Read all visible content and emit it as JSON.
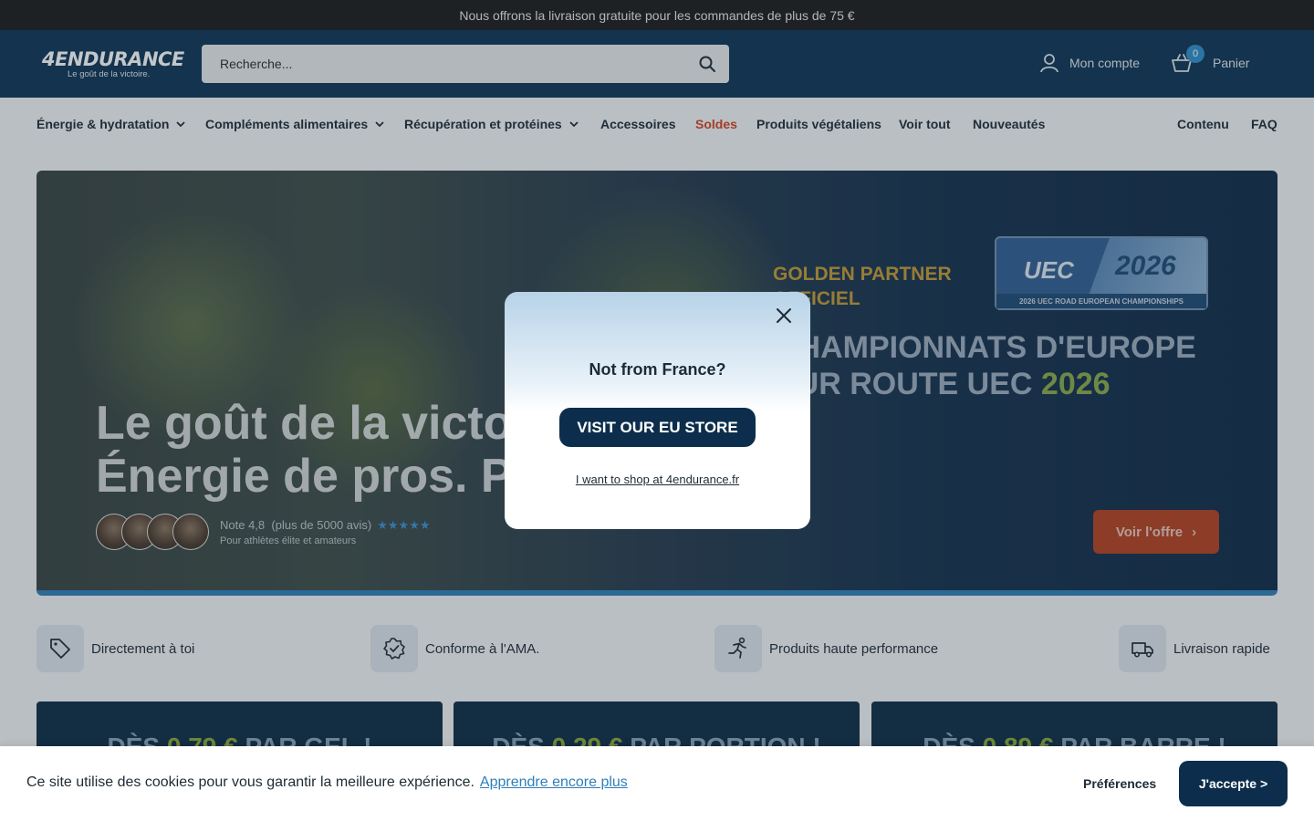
{
  "announcement": {
    "text": "Nous offrons la livraison gratuite pour les commandes de plus de 75 €"
  },
  "header": {
    "logo_text": "4ENDURANCE",
    "logo_tagline": "Le goût de la victoire.",
    "search_placeholder": "Recherche...",
    "account_label": "Mon compte",
    "cart_label": "Panier",
    "cart_count": "0"
  },
  "nav": {
    "items": [
      {
        "label": "Énergie & hydratation",
        "dropdown": true
      },
      {
        "label": "Compléments alimentaires",
        "dropdown": true
      },
      {
        "label": "Récupération et protéines",
        "dropdown": true
      },
      {
        "label": "Accessoires"
      },
      {
        "label": "Soldes",
        "color": "#d2421f"
      },
      {
        "label": "Produits végétaliens"
      },
      {
        "label": "Voir tout"
      },
      {
        "label": "Nouveautés"
      }
    ],
    "right_items": [
      {
        "label": "Contenu"
      },
      {
        "label": "FAQ"
      }
    ]
  },
  "hero": {
    "title_line1": "Le goût de la victoi",
    "title_line2": "Énergie de pros. Pr",
    "partner_line1": "GOLDEN PARTNER",
    "partner_line2": "OFFICIEL",
    "champ_line1": "CHAMPIONNATS D'EUROPE",
    "champ_line2_pre": "SUR ROUTE UEC ",
    "champ_line2_year": "2026",
    "badge_uec": "UEC",
    "badge_year": "2026",
    "badge_strip": "2026 UEC ROAD EUROPEAN CHAMPIONSHIPS",
    "rating_label": "Note 4,8",
    "rating_count": "(plus de 5000 avis)",
    "rating_stars": "★★★★★",
    "rating_stars_value": 4.8,
    "rating_sub": "Pour athlètes élite et amateurs",
    "offer_button": "Voir l'offre"
  },
  "features": [
    {
      "label": "Directement à toi",
      "icon": "tag-icon"
    },
    {
      "label": "Conforme à l'AMA.",
      "icon": "badge-check-icon"
    },
    {
      "label": "Produits haute performance",
      "icon": "runner-icon"
    },
    {
      "label": "Livraison rapide",
      "icon": "delivery-truck-icon"
    }
  ],
  "cards": [
    {
      "pre": "DÈS ",
      "price": "0,79 €",
      "post": " PAR GEL !"
    },
    {
      "pre": "DÈS ",
      "price": "0,29 €",
      "post": " PAR PORTION !"
    },
    {
      "pre": "DÈS ",
      "price": "0,89 €",
      "post": " PAR BARRE !"
    }
  ],
  "modal": {
    "title": "Not from France?",
    "eu_button": "VISIT OUR EU STORE",
    "fr_link": "I want to shop at 4endurance.fr"
  },
  "cookie": {
    "text": "Ce site utilise des cookies pour vous garantir la meilleure expérience.",
    "learn_more": "Apprendre encore plus",
    "preferences": "Préférences",
    "accept": "J'accepte >"
  },
  "colors": {
    "header_bg": "#0c3455",
    "primary_dark": "#0c2e4c",
    "sale_red": "#d2421f",
    "offer_orange": "#b5401f",
    "accent_blue": "#2f8ec9"
  }
}
